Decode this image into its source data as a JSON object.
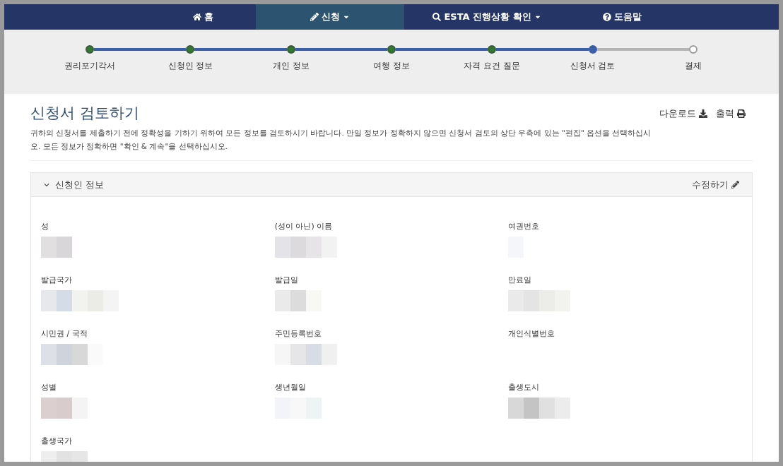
{
  "nav": [
    {
      "label": "홈",
      "selected": false,
      "dropdown": false
    },
    {
      "label": "신청",
      "selected": true,
      "dropdown": true
    },
    {
      "label": "ESTA 진행상황 확인",
      "selected": false,
      "dropdown": true
    },
    {
      "label": "도움말",
      "selected": false,
      "dropdown": false
    }
  ],
  "steps": [
    {
      "label": "권리포기각서",
      "completed": true,
      "selected": false
    },
    {
      "label": "신청인 정보",
      "completed": true,
      "selected": false
    },
    {
      "label": "개인 정보",
      "completed": true,
      "selected": false
    },
    {
      "label": "여행 정보",
      "completed": true,
      "selected": false
    },
    {
      "label": "자격 요건 질문",
      "completed": true,
      "selected": false
    },
    {
      "label": "신청서 검토",
      "completed": false,
      "selected": true
    },
    {
      "label": "결제",
      "completed": false,
      "selected": false
    }
  ],
  "page": {
    "title": "신청서 검토하기",
    "description": "귀하의 신청서를 제출하기 전에 정확성을 기하기 위하여 모든 정보를 검토하시기 바랍니다. 만일 정보가 정확하지 않으면 신청서 검토의 상단 우측에 있는 \"편집\" 옵션을 선택하십시오. 모든 정보가 정확하면 \"확인 & 계속\"을 선택하십시오.",
    "download": "다운로드",
    "print": "출력"
  },
  "section": {
    "title": "신청인 정보",
    "expanded": true,
    "edit": "수정하기",
    "fields": [
      {
        "label": "성"
      },
      {
        "label": "(성이 아닌) 이름"
      },
      {
        "label": "여권번호"
      },
      {
        "label": "발급국가"
      },
      {
        "label": "발급일"
      },
      {
        "label": "만료일"
      },
      {
        "label": "시민권 / 국적"
      },
      {
        "label": "주민등록번호"
      },
      {
        "label": "개인식별번호"
      },
      {
        "label": "성별"
      },
      {
        "label": "생년월일"
      },
      {
        "label": "출생도시"
      },
      {
        "label": "출생국가"
      }
    ]
  }
}
